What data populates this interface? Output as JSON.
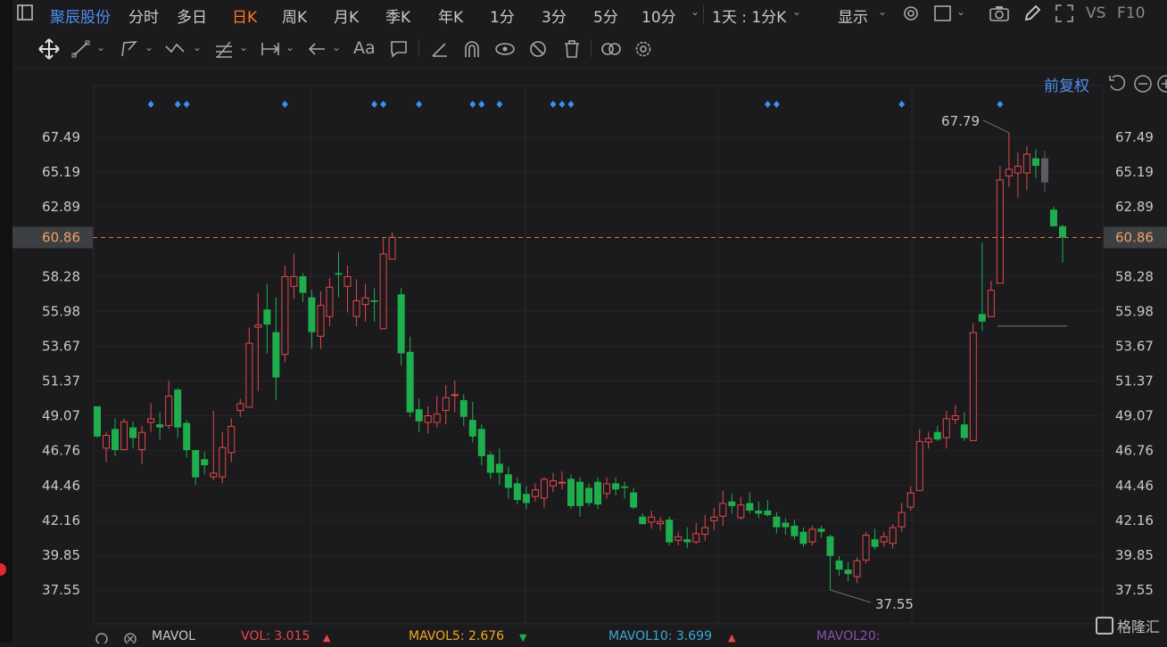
{
  "header": {
    "stock_name": "聚辰股份",
    "tabs": [
      "分时",
      "多日",
      "日K",
      "周K",
      "月K",
      "季K",
      "年K",
      "1分",
      "3分",
      "5分",
      "10分"
    ],
    "active_tab": "日K",
    "period_select": "1天 : 1分K",
    "display_label": "显示",
    "vs_label": "VS",
    "f10_label": "F10"
  },
  "chart_toolbar": {
    "font_tool_label": "Aa"
  },
  "chart": {
    "adjust_label": "前复权",
    "current_price_label": "60.86",
    "high_label": "67.79",
    "low_label": "37.55",
    "watermark": "格隆汇"
  },
  "chart_data": {
    "type": "candlestick",
    "title": "",
    "y_ticks": [
      67.49,
      65.19,
      62.89,
      60.86,
      58.28,
      55.98,
      53.67,
      51.37,
      49.07,
      46.76,
      44.46,
      42.16,
      39.85,
      37.55
    ],
    "y_tick_labels": [
      "67.49",
      "65.19",
      "62.89",
      "60.86",
      "58.28",
      "55.98",
      "53.67",
      "51.37",
      "49.07",
      "46.76",
      "44.46",
      "42.16",
      "39.85",
      "37.55"
    ],
    "ylim": [
      36.4,
      70.6
    ],
    "current_price": 60.86,
    "max_marker": 67.79,
    "min_marker": 37.55,
    "up_color": "#e5474b",
    "down_color": "#1fae4e",
    "candles": [
      [
        49.7,
        47.7,
        49.7,
        47.6
      ],
      [
        46.9,
        47.8,
        48.0,
        46.0
      ],
      [
        48.2,
        46.8,
        48.9,
        46.4
      ],
      [
        46.8,
        48.7,
        48.9,
        46.8
      ],
      [
        48.3,
        47.6,
        48.7,
        46.9
      ],
      [
        46.8,
        48.0,
        48.4,
        45.9
      ],
      [
        48.6,
        48.9,
        49.9,
        48.0
      ],
      [
        48.5,
        48.3,
        49.3,
        47.5
      ],
      [
        48.4,
        50.4,
        51.4,
        48.2
      ],
      [
        50.8,
        48.3,
        50.9,
        47.6
      ],
      [
        48.6,
        46.8,
        48.8,
        46.3
      ],
      [
        46.8,
        45.0,
        46.8,
        44.5
      ],
      [
        46.2,
        45.8,
        46.7,
        45.2
      ],
      [
        45.0,
        45.3,
        49.4,
        44.8
      ],
      [
        45.0,
        47.0,
        48.0,
        44.6
      ],
      [
        46.6,
        48.4,
        48.9,
        46.0
      ],
      [
        49.4,
        49.9,
        50.2,
        49.0
      ],
      [
        49.6,
        53.9,
        54.9,
        49.6
      ],
      [
        54.9,
        55.1,
        57.2,
        50.7
      ],
      [
        56.1,
        55.1,
        57.8,
        53.2
      ],
      [
        54.6,
        51.6,
        56.9,
        50.1
      ],
      [
        53.1,
        58.3,
        59.0,
        52.6
      ],
      [
        57.6,
        58.3,
        59.8,
        56.8
      ],
      [
        58.3,
        57.2,
        58.5,
        56.6
      ],
      [
        56.9,
        54.6,
        57.4,
        53.5
      ],
      [
        54.3,
        56.4,
        57.3,
        53.5
      ],
      [
        55.6,
        57.6,
        58.2,
        55.0
      ],
      [
        58.5,
        58.4,
        59.9,
        56.9
      ],
      [
        57.6,
        58.3,
        59.0,
        55.9
      ],
      [
        55.6,
        56.7,
        58.1,
        55.0
      ],
      [
        56.4,
        56.9,
        57.8,
        55.3
      ],
      [
        56.7,
        56.6,
        57.5,
        55.3
      ],
      [
        54.8,
        59.8,
        60.8,
        54.8
      ],
      [
        59.4,
        60.9,
        61.2,
        59.4
      ],
      [
        57.1,
        53.2,
        57.5,
        52.4
      ],
      [
        53.3,
        49.3,
        54.3,
        49.0
      ],
      [
        49.5,
        48.7,
        50.2,
        48.0
      ],
      [
        48.6,
        49.1,
        49.7,
        47.9
      ],
      [
        48.6,
        49.2,
        50.4,
        48.3
      ],
      [
        49.4,
        50.3,
        51.1,
        48.5
      ],
      [
        50.4,
        50.5,
        51.4,
        49.3
      ],
      [
        50.1,
        49.0,
        50.5,
        48.4
      ],
      [
        48.8,
        47.7,
        50.0,
        47.3
      ],
      [
        48.2,
        46.4,
        48.5,
        45.8
      ],
      [
        46.5,
        45.3,
        46.7,
        44.9
      ],
      [
        45.9,
        45.3,
        46.9,
        44.5
      ],
      [
        45.2,
        44.3,
        45.7,
        43.6
      ],
      [
        44.6,
        43.5,
        45.0,
        43.2
      ],
      [
        43.9,
        43.3,
        44.4,
        42.9
      ],
      [
        43.7,
        44.2,
        44.6,
        43.4
      ],
      [
        43.6,
        44.9,
        45.0,
        43.0
      ],
      [
        44.4,
        44.8,
        45.3,
        44.0
      ],
      [
        44.6,
        44.7,
        45.4,
        44.2
      ],
      [
        44.9,
        43.1,
        45.2,
        42.9
      ],
      [
        44.7,
        43.1,
        45.0,
        42.4
      ],
      [
        44.3,
        43.3,
        44.6,
        43.1
      ],
      [
        44.7,
        43.2,
        45.0,
        42.9
      ],
      [
        43.9,
        44.6,
        45.0,
        43.6
      ],
      [
        44.6,
        44.2,
        45.0,
        43.8
      ],
      [
        44.4,
        44.3,
        44.7,
        43.6
      ],
      [
        44.0,
        43.0,
        44.3,
        42.9
      ],
      [
        42.4,
        41.9,
        42.6,
        41.9
      ],
      [
        42.0,
        42.4,
        42.8,
        41.6
      ],
      [
        41.9,
        42.1,
        42.4,
        41.5
      ],
      [
        42.2,
        40.7,
        42.4,
        40.5
      ],
      [
        40.8,
        41.1,
        41.4,
        40.5
      ],
      [
        40.9,
        40.7,
        41.7,
        40.3
      ],
      [
        40.7,
        41.3,
        42.0,
        40.6
      ],
      [
        41.2,
        41.7,
        42.5,
        40.8
      ],
      [
        42.1,
        42.4,
        43.0,
        41.5
      ],
      [
        42.4,
        43.3,
        44.1,
        41.8
      ],
      [
        43.4,
        43.1,
        43.9,
        42.6
      ],
      [
        42.3,
        43.2,
        43.7,
        42.2
      ],
      [
        43.3,
        42.8,
        44.0,
        42.6
      ],
      [
        42.8,
        42.6,
        43.4,
        42.3
      ],
      [
        42.8,
        42.5,
        43.5,
        42.4
      ],
      [
        42.4,
        41.7,
        42.7,
        41.3
      ],
      [
        42.0,
        41.7,
        42.3,
        41.2
      ],
      [
        41.8,
        41.1,
        42.2,
        40.9
      ],
      [
        41.4,
        40.6,
        41.7,
        40.4
      ],
      [
        40.7,
        41.6,
        41.8,
        40.5
      ],
      [
        41.6,
        41.4,
        41.8,
        41.0
      ],
      [
        41.1,
        39.8,
        41.2,
        37.55
      ],
      [
        39.5,
        38.9,
        39.8,
        38.5
      ],
      [
        38.9,
        38.6,
        39.4,
        38.1
      ],
      [
        38.4,
        39.5,
        39.7,
        38.0
      ],
      [
        39.5,
        41.2,
        41.4,
        39.3
      ],
      [
        40.9,
        40.4,
        41.6,
        40.2
      ],
      [
        40.7,
        41.1,
        41.4,
        40.4
      ],
      [
        40.6,
        41.7,
        41.9,
        40.3
      ],
      [
        41.7,
        42.7,
        43.3,
        41.4
      ],
      [
        43.0,
        44.0,
        44.4,
        42.8
      ],
      [
        44.1,
        47.4,
        48.2,
        44.1
      ],
      [
        47.3,
        47.6,
        48.0,
        46.9
      ],
      [
        48.0,
        47.5,
        48.4,
        47.4
      ],
      [
        47.6,
        48.9,
        49.4,
        46.9
      ],
      [
        48.8,
        49.1,
        49.8,
        48.5
      ],
      [
        48.5,
        47.6,
        49.3,
        47.4
      ],
      [
        47.4,
        54.6,
        55.2,
        47.4
      ],
      [
        55.8,
        55.3,
        60.5,
        54.7
      ],
      [
        55.6,
        57.4,
        58.0,
        55.6
      ],
      [
        57.8,
        64.7,
        65.6,
        57.8
      ],
      [
        64.9,
        65.4,
        67.79,
        64.2
      ],
      [
        65.1,
        65.6,
        66.5,
        63.5
      ],
      [
        65.1,
        66.4,
        66.9,
        64.0
      ],
      [
        66.1,
        65.6,
        66.7,
        64.8
      ],
      [
        66.1,
        64.5,
        66.6,
        63.9
      ],
      [
        62.7,
        61.6,
        62.9,
        61.6
      ],
      [
        61.6,
        60.86,
        61.7,
        59.2
      ]
    ],
    "gray_candles": [
      106
    ],
    "markers_on_candles": [
      6,
      9,
      10,
      21,
      31,
      32,
      36,
      42,
      43,
      45,
      51,
      52,
      53,
      75,
      76,
      90,
      101
    ]
  },
  "volume_legend": {
    "name": "MAVOL",
    "vol": "VOL: 3.015",
    "mavol5": "MAVOL5: 2.676",
    "mavol10": "MAVOL10: 3.699",
    "mavol20": "MAVOL20:",
    "colors": {
      "vol": "#e5474b",
      "mavol5": "#f5a623",
      "mavol10": "#3aa8d8",
      "mavol20": "#8a4fa8"
    }
  }
}
